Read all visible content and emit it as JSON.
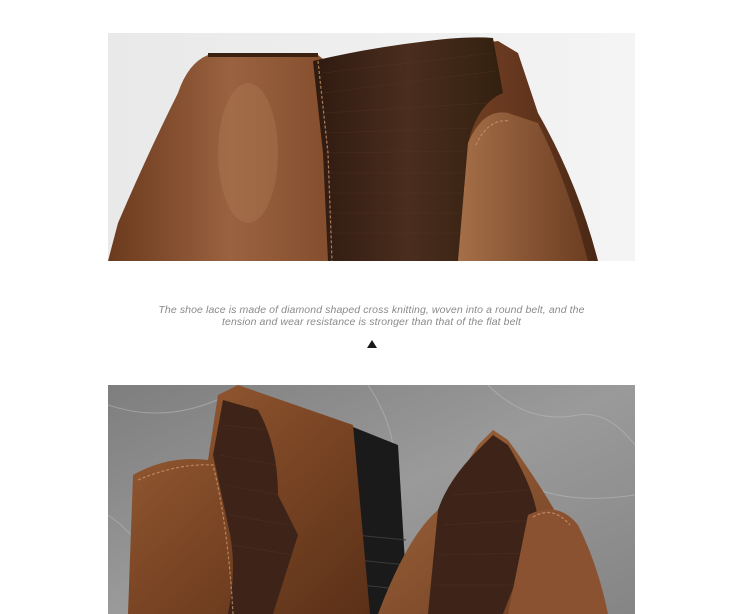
{
  "caption": {
    "line1": "The shoe lace is made of diamond shaped cross knitting, woven into a round belt, and the",
    "line2": "tension and wear resistance is stronger than that of the flat belt"
  },
  "images": {
    "top": {
      "subject": "brown-leather-chelsea-boot-closeup"
    },
    "bottom": {
      "subject": "pair-of-brown-chelsea-boots-on-marble"
    }
  },
  "colors": {
    "leather": "#8a5230",
    "leather_dark": "#4e2a16",
    "elastic": "#3e2418",
    "marble": "#8d8d8d",
    "caption_text": "#8a8a8a"
  },
  "icons": {
    "arrow": "triangle-up-icon"
  }
}
